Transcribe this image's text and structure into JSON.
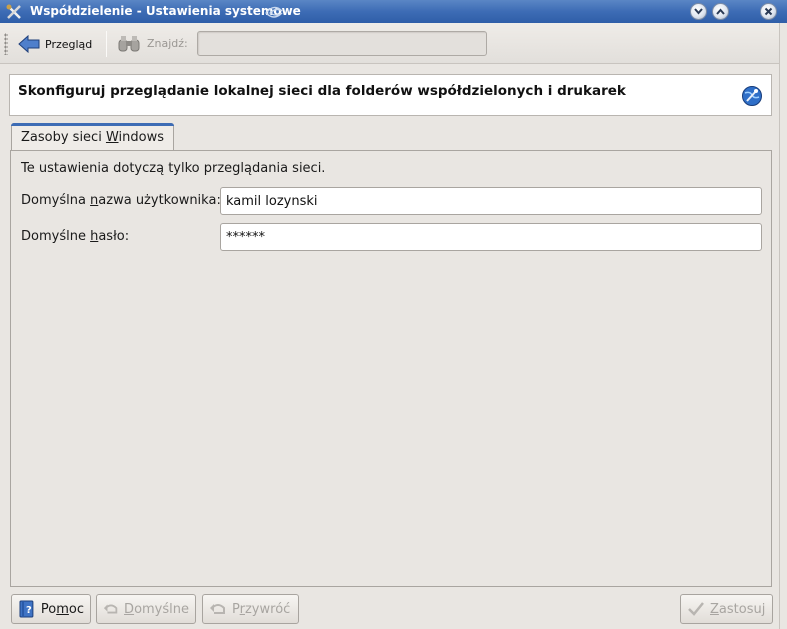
{
  "window": {
    "title": "Współdzielenie - Ustawienia systemowe",
    "icons": [
      "app-tools-icon",
      "kde-swirl-icon",
      "minimize-icon",
      "maximize-icon",
      "close-icon"
    ]
  },
  "toolbar": {
    "back_label": "Przegląd",
    "find_label": "Znajdź:",
    "find_value": ""
  },
  "banner": {
    "heading": "Skonfiguruj przeglądanie lokalnej sieci dla folderów współdzielonych i drukarek"
  },
  "tabs": [
    {
      "label_pre": "Zasoby sieci ",
      "label_ul": "W",
      "label_post": "indows",
      "selected": true
    }
  ],
  "panel": {
    "info_text": "Te ustawienia dotyczą tylko przeglądania sieci.",
    "username": {
      "label_pre": "Domyślna ",
      "label_ul": "n",
      "label_post": "azwa użytkownika:",
      "value": "kamil lozynski"
    },
    "password": {
      "label_pre": "Domyślne ",
      "label_ul": "h",
      "label_post": "asło:",
      "value": "******"
    }
  },
  "buttons": {
    "help": {
      "pre": "Po",
      "ul": "m",
      "post": "oc"
    },
    "defaults": {
      "pre": "",
      "ul": "D",
      "post": "omyślne"
    },
    "reset": {
      "pre": "P",
      "ul": "r",
      "post": "zywróć"
    },
    "apply": {
      "pre": "",
      "ul": "Z",
      "post": "astosuj"
    }
  }
}
